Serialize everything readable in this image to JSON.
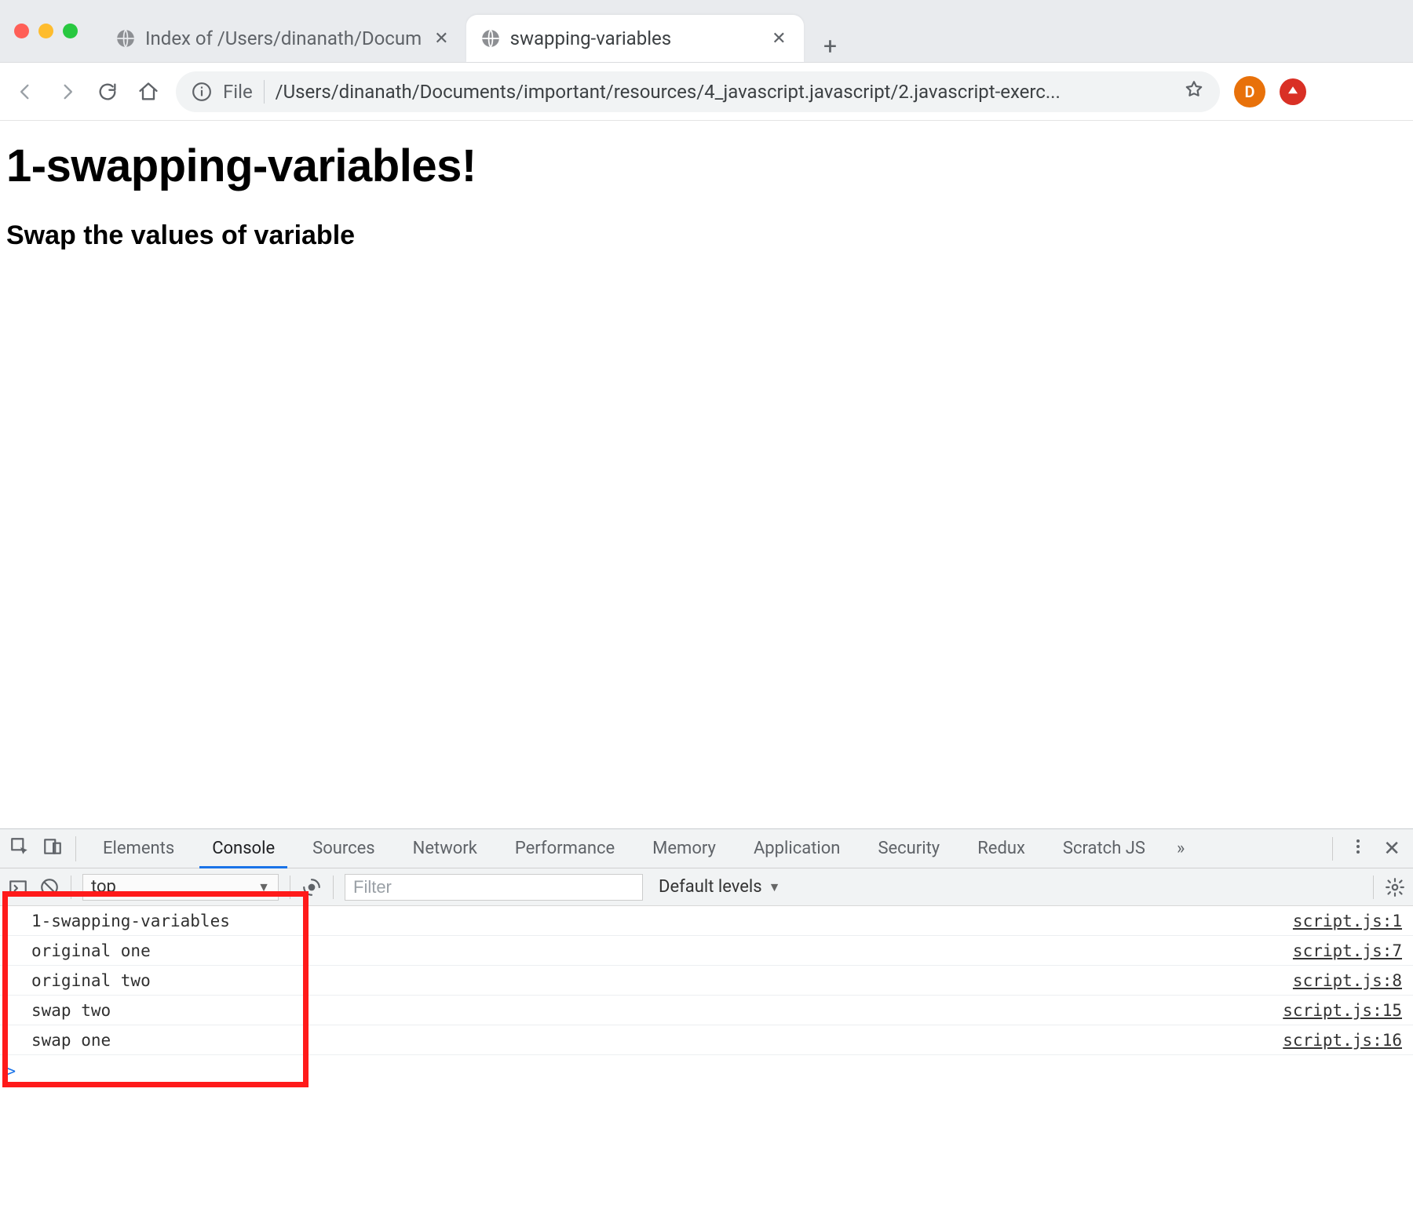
{
  "window": {
    "tabs": [
      {
        "title": "Index of /Users/dinanath/Docum",
        "active": false
      },
      {
        "title": "swapping-variables",
        "active": true
      }
    ]
  },
  "toolbar": {
    "scheme_label": "File",
    "url": "/Users/dinanath/Documents/important/resources/4_javascript.javascript/2.javascript-exerc...",
    "avatar_letter": "D"
  },
  "page": {
    "h1": "1-swapping-variables!",
    "h3": "Swap the values of variable"
  },
  "devtools": {
    "panels": [
      "Elements",
      "Console",
      "Sources",
      "Network",
      "Performance",
      "Memory",
      "Application",
      "Security",
      "Redux",
      "Scratch JS"
    ],
    "active_panel": "Console",
    "context": "top",
    "filter_placeholder": "Filter",
    "levels_label": "Default levels",
    "logs": [
      {
        "msg": "1-swapping-variables",
        "src": "script.js:1"
      },
      {
        "msg": "original one",
        "src": "script.js:7"
      },
      {
        "msg": "original two",
        "src": "script.js:8"
      },
      {
        "msg": "swap two",
        "src": "script.js:15"
      },
      {
        "msg": "swap one",
        "src": "script.js:16"
      }
    ],
    "prompt": ">"
  }
}
